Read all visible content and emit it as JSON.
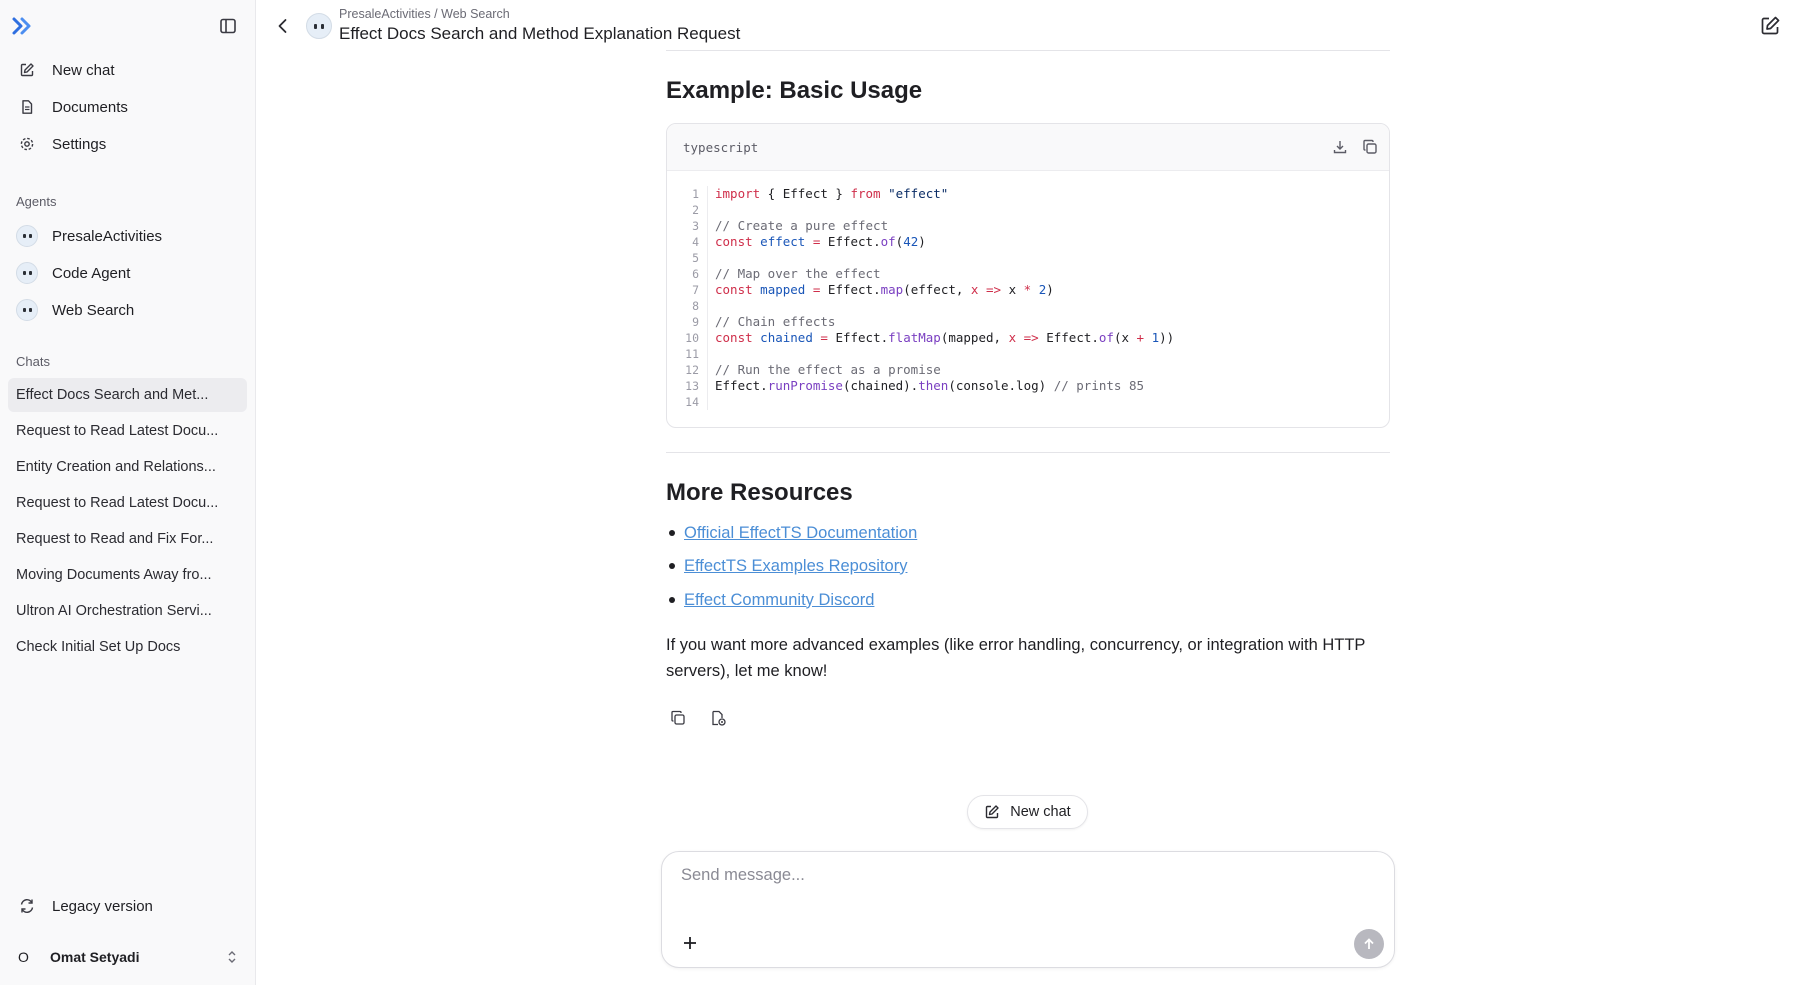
{
  "sidebar": {
    "nav": [
      {
        "label": "New chat",
        "icon": "pencil-square-icon"
      },
      {
        "label": "Documents",
        "icon": "document-icon"
      },
      {
        "label": "Settings",
        "icon": "gear-icon"
      }
    ],
    "agents_label": "Agents",
    "agents": [
      {
        "label": "PresaleActivities"
      },
      {
        "label": "Code Agent"
      },
      {
        "label": "Web Search"
      }
    ],
    "chats_label": "Chats",
    "chats": [
      {
        "label": "Effect Docs Search and Met...",
        "active": true
      },
      {
        "label": "Request to Read Latest Docu..."
      },
      {
        "label": "Entity Creation and Relations..."
      },
      {
        "label": "Request to Read Latest Docu..."
      },
      {
        "label": "Request to Read and Fix For..."
      },
      {
        "label": "Moving Documents Away fro..."
      },
      {
        "label": "Ultron AI Orchestration Servi..."
      },
      {
        "label": "Check Initial Set Up Docs"
      }
    ],
    "legacy_label": "Legacy version",
    "user": {
      "initial": "O",
      "name": "Omat Setyadi"
    }
  },
  "header": {
    "breadcrumb": "PresaleActivities / Web Search",
    "title": "Effect Docs Search and Method Explanation Request"
  },
  "main": {
    "example_heading": "Example: Basic Usage",
    "code": {
      "language": "typescript",
      "line_numbers": [
        "1",
        "2",
        "3",
        "4",
        "5",
        "6",
        "7",
        "8",
        "9",
        "10",
        "11",
        "12",
        "13",
        "14"
      ]
    },
    "resources_heading": "More Resources",
    "resources": [
      {
        "label": "Official EffectTS Documentation"
      },
      {
        "label": "EffectTS Examples Repository"
      },
      {
        "label": "Effect Community Discord"
      }
    ],
    "closing_text": "If you want more advanced examples (like error handling, concurrency, or integration with HTTP servers), let me know!",
    "new_chat_label": "New chat",
    "composer_placeholder": "Send message..."
  },
  "colors": {
    "accent_link": "#4b8ed6",
    "sidebar_bg": "#f9f9fa",
    "active_chat_bg": "#ececef",
    "keyword": "#cf2e4a",
    "function": "#7a3fc1",
    "variable": "#1a56b8"
  }
}
